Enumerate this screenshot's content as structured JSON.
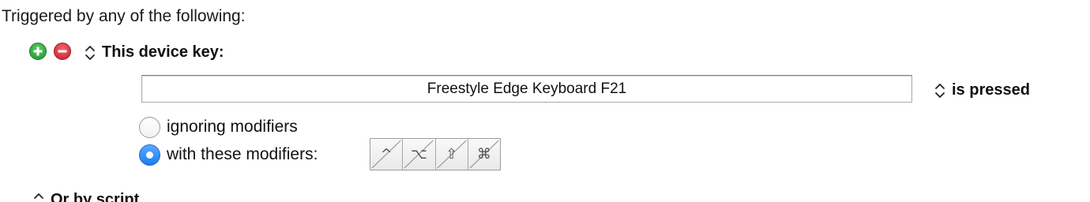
{
  "heading": "Triggered by any of the following:",
  "trigger": {
    "add_icon": "plus-circle-green",
    "remove_icon": "minus-circle-red",
    "type_label": "This device key:",
    "device_key_value": "Freestyle Edge Keyboard F21",
    "condition_label": "is pressed"
  },
  "modifiers": {
    "ignoring_label": "ignoring modifiers",
    "with_label": "with these modifiers:",
    "selected": "with",
    "keys": [
      {
        "name": "control",
        "glyph": "^",
        "active": false
      },
      {
        "name": "option",
        "glyph": "⌥",
        "active": false
      },
      {
        "name": "shift",
        "glyph": "⇧",
        "active": false
      },
      {
        "name": "command",
        "glyph": "⌘",
        "active": false
      }
    ]
  },
  "script": {
    "label": "Or by script"
  },
  "colors": {
    "add": "#2fa43c",
    "remove": "#d6303c",
    "radio_selected": "#1c7ef0"
  }
}
